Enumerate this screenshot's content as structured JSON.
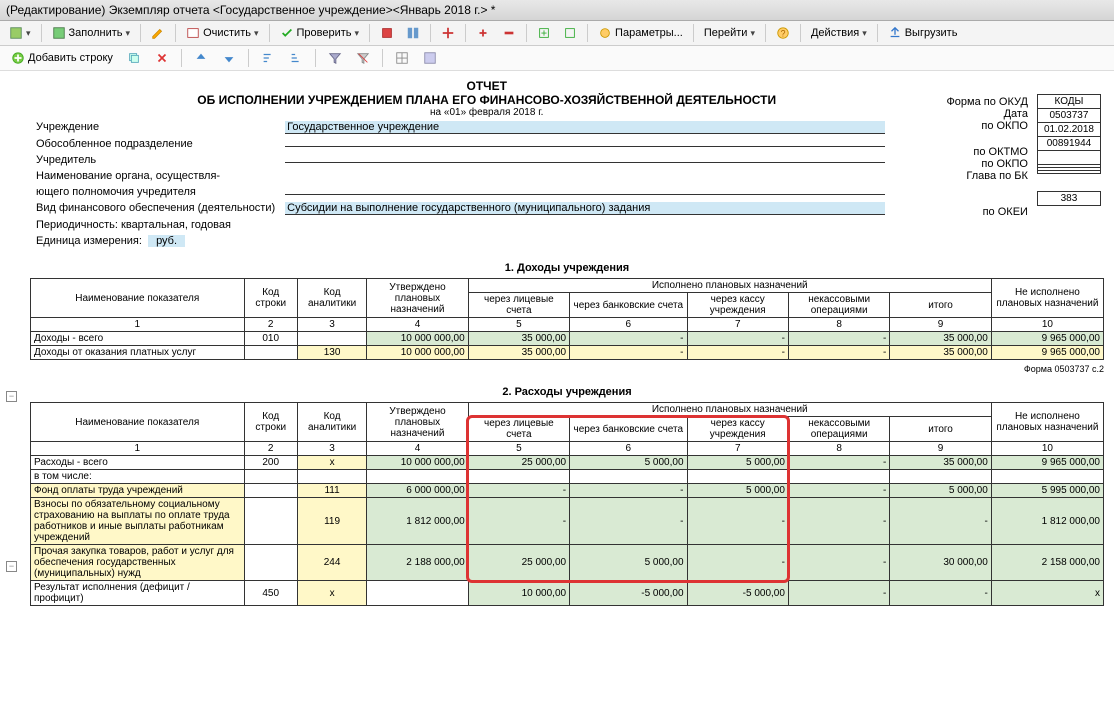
{
  "title": "(Редактирование) Экземпляр отчета <Государственное учреждение><Январь 2018 г.> *",
  "toolbar": {
    "fill": "Заполнить",
    "clear": "Очистить",
    "check": "Проверить",
    "params": "Параметры...",
    "goto": "Перейти",
    "actions": "Действия",
    "upload": "Выгрузить"
  },
  "icobar": {
    "addrow": "Добавить строку"
  },
  "report": {
    "t1": "ОТЧЕТ",
    "t2": "ОБ ИСПОЛНЕНИИ УЧРЕЖДЕНИЕМ ПЛАНА ЕГО ФИНАНСОВО-ХОЗЯЙСТВЕННОЙ ДЕЯТЕЛЬНОСТИ",
    "ondate": "на «01» февраля 2018 г.",
    "labels": {
      "inst": "Учреждение",
      "subdiv": "Обособленное подразделение",
      "founder": "Учредитель",
      "org1": "Наименование органа, осуществля-",
      "org2": "ющего полномочия учредителя",
      "fintype": "Вид финансового обеспечения (деятельности)",
      "period": "Периодичность: квартальная, годовая",
      "unit": "Единица измерения:",
      "rub": "руб."
    },
    "vals": {
      "inst": "Государственное учреждение",
      "fintype": "Субсидии на выполнение государственного (муниципального) задания"
    },
    "right": {
      "okud": "Форма по ОКУД",
      "date": "Дата",
      "okpo": "по ОКПО",
      "oktmo": "по ОКТМО",
      "okpo2": "по ОКПО",
      "bk": "Глава по БК",
      "okei": "по ОКЕИ"
    },
    "codes": {
      "head": "КОДЫ",
      "okud": "0503737",
      "date": "01.02.2018",
      "okpo": "00891944",
      "oktmo": "",
      "okpo2": "",
      "bk": "",
      "okei": "383"
    }
  },
  "sec1": {
    "title": "1. Доходы учреждения",
    "cols": {
      "name": "Наименование показателя",
      "line": "Код строки",
      "anal": "Код аналитики",
      "appr": "Утверждено плановых назначений",
      "exec": "Исполнено плановых назначений",
      "lic": "через лицевые счета",
      "bank": "через банковские счета",
      "cash": "через кассу учреждения",
      "noncash": "некассовыми операциями",
      "total": "итого",
      "notexec": "Не исполнено плановых назначений"
    },
    "nums": {
      "1": "1",
      "2": "2",
      "3": "3",
      "4": "4",
      "5": "5",
      "6": "6",
      "7": "7",
      "8": "8",
      "9": "9",
      "10": "10"
    },
    "rows": [
      {
        "name": "Доходы - всего",
        "line": "010",
        "anal": "",
        "appr": "10 000 000,00",
        "c5": "35 000,00",
        "c6": "-",
        "c7": "-",
        "c8": "-",
        "c9": "35 000,00",
        "c10": "9 965 000,00",
        "cls": ""
      },
      {
        "name": "Доходы от оказания платных услуг",
        "line": "",
        "anal": "130",
        "appr": "10 000 000,00",
        "c5": "35 000,00",
        "c6": "-",
        "c7": "-",
        "c8": "-",
        "c9": "35 000,00",
        "c10": "9 965 000,00",
        "cls": "ye"
      }
    ]
  },
  "formnote": "Форма 0503737  с.2",
  "sec2": {
    "title": "2. Расходы учреждения",
    "rows": [
      {
        "name": "Расходы - всего",
        "line": "200",
        "anal": "х",
        "appr": "10 000 000,00",
        "c5": "25 000,00",
        "c6": "5 000,00",
        "c7": "5 000,00",
        "c8": "-",
        "c9": "35 000,00",
        "c10": "9 965 000,00",
        "cls": "gr",
        "lcls": ""
      },
      {
        "name": "    в том числе:",
        "line": "",
        "anal": "",
        "appr": "",
        "c5": "",
        "c6": "",
        "c7": "",
        "c8": "",
        "c9": "",
        "c10": "",
        "cls": "",
        "lcls": ""
      },
      {
        "name": "Фонд оплаты труда учреждений",
        "line": "",
        "anal": "111",
        "appr": "6 000 000,00",
        "c5": "-",
        "c6": "-",
        "c7": "5 000,00",
        "c8": "-",
        "c9": "5 000,00",
        "c10": "5 995 000,00",
        "cls": "",
        "lcls": "ye"
      },
      {
        "name": "Взносы по обязательному социальному страхованию на выплаты по оплате труда работников и иные выплаты работникам учреждений",
        "line": "",
        "anal": "119",
        "appr": "1 812 000,00",
        "c5": "-",
        "c6": "-",
        "c7": "-",
        "c8": "-",
        "c9": "-",
        "c10": "1 812 000,00",
        "cls": "",
        "lcls": "ye"
      },
      {
        "name": "Прочая закупка товаров, работ и услуг для обеспечения государственных (муниципальных) нужд",
        "line": "",
        "anal": "244",
        "appr": "2 188 000,00",
        "c5": "25 000,00",
        "c6": "5 000,00",
        "c7": "-",
        "c8": "-",
        "c9": "30 000,00",
        "c10": "2 158 000,00",
        "cls": "",
        "lcls": "ye"
      },
      {
        "name": "Результат исполнения  (дефицит / профицит)",
        "line": "450",
        "anal": "х",
        "appr": "",
        "c5": "10 000,00",
        "c6": "-5 000,00",
        "c7": "-5 000,00",
        "c8": "-",
        "c9": "-",
        "c10": "х",
        "cls": "",
        "lcls": ""
      }
    ]
  }
}
